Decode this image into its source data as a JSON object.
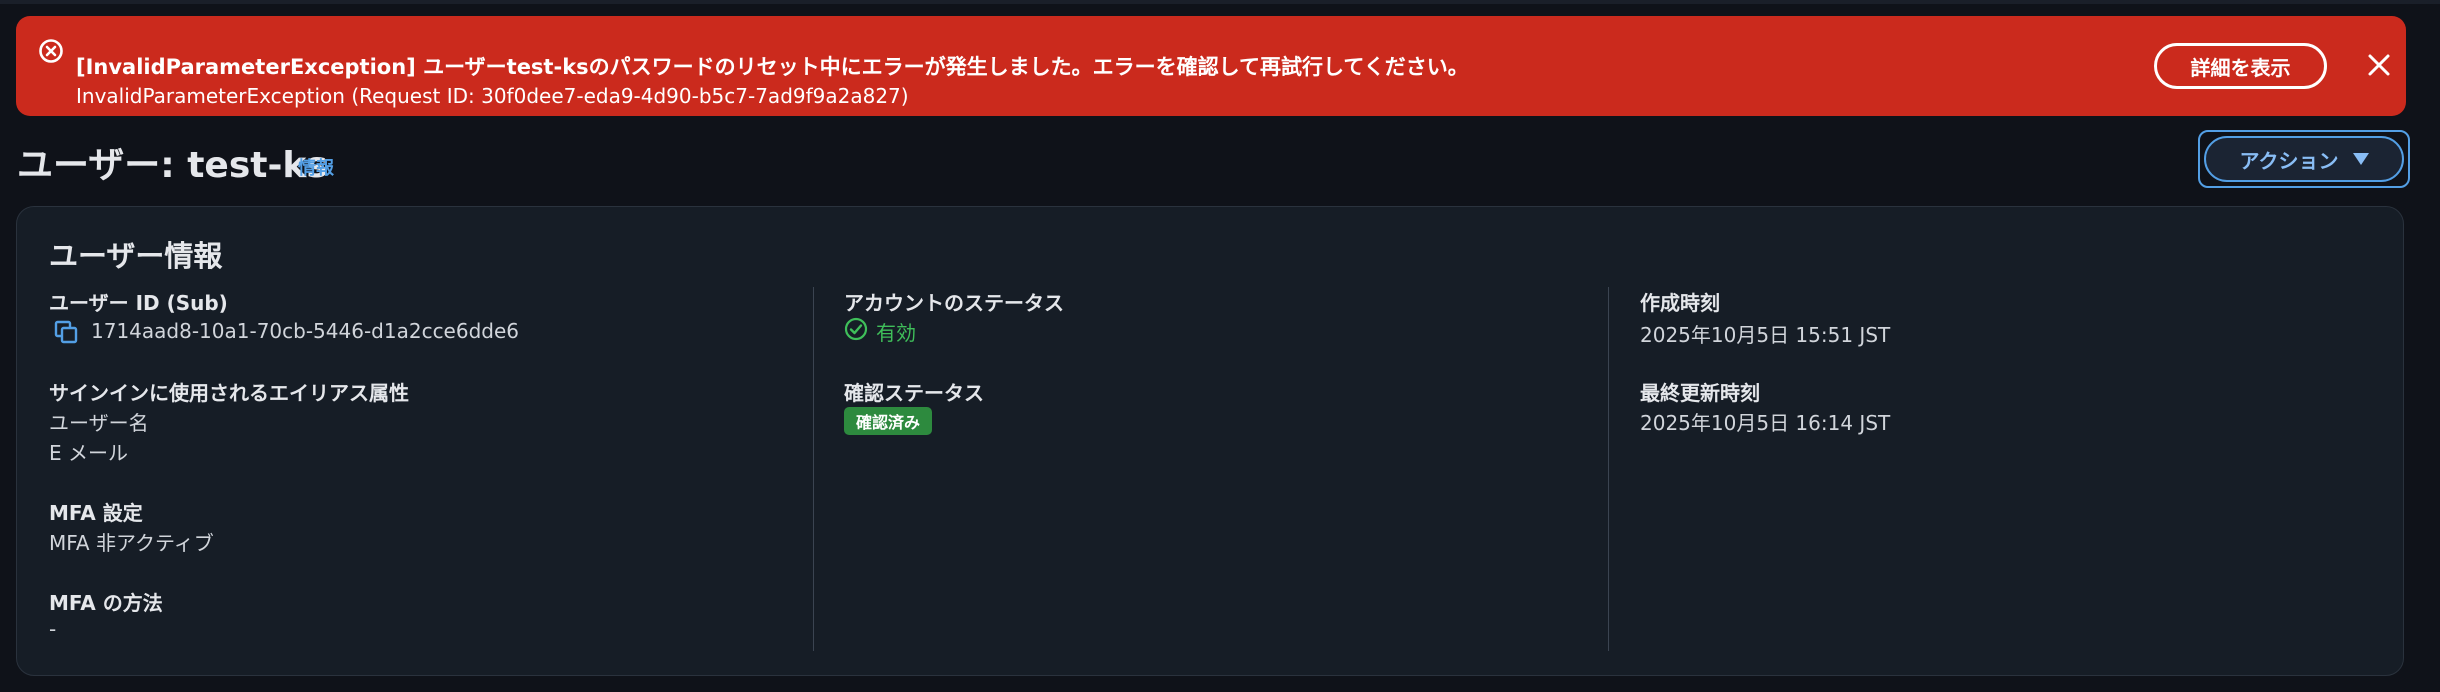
{
  "error_banner": {
    "title": "[InvalidParameterException] ユーザーtest-ksのパスワードのリセット中にエラーが発生しました。エラーを確認して再試行してください。",
    "detail": "InvalidParameterException (Request ID: 30f0dee7-eda9-4d90-b5c7-7ad9f9a2a827)",
    "view_details_label": "詳細を表示",
    "icon": "error-circle-icon",
    "close_icon": "close-icon",
    "color": "#cb2a1d"
  },
  "header": {
    "title": "ユーザー: test-ks",
    "info_link": "情報",
    "actions_label": "アクション"
  },
  "user_info": {
    "title": "ユーザー情報",
    "user_id_label": "ユーザー ID (Sub)",
    "user_id_value": "1714aad8-10a1-70cb-5446-d1a2cce6dde6",
    "alias_label": "サインインに使用されるエイリアス属性",
    "alias_values": [
      "ユーザー名",
      "E メール"
    ],
    "mfa_setting_label": "MFA 設定",
    "mfa_setting_value": "MFA 非アクティブ",
    "mfa_method_label": "MFA の方法",
    "mfa_method_value": "-",
    "account_status_label": "アカウントのステータス",
    "account_status_value": "有効",
    "confirmation_status_label": "確認ステータス",
    "confirmation_status_value": "確認済み",
    "created_label": "作成時刻",
    "created_value": "2025年10月5日 15:51 JST",
    "updated_label": "最終更新時刻",
    "updated_value": "2025年10月5日 16:14 JST"
  },
  "colors": {
    "accent": "#539fe5",
    "success": "#3fbf5a",
    "badge": "#2d8a3e"
  }
}
